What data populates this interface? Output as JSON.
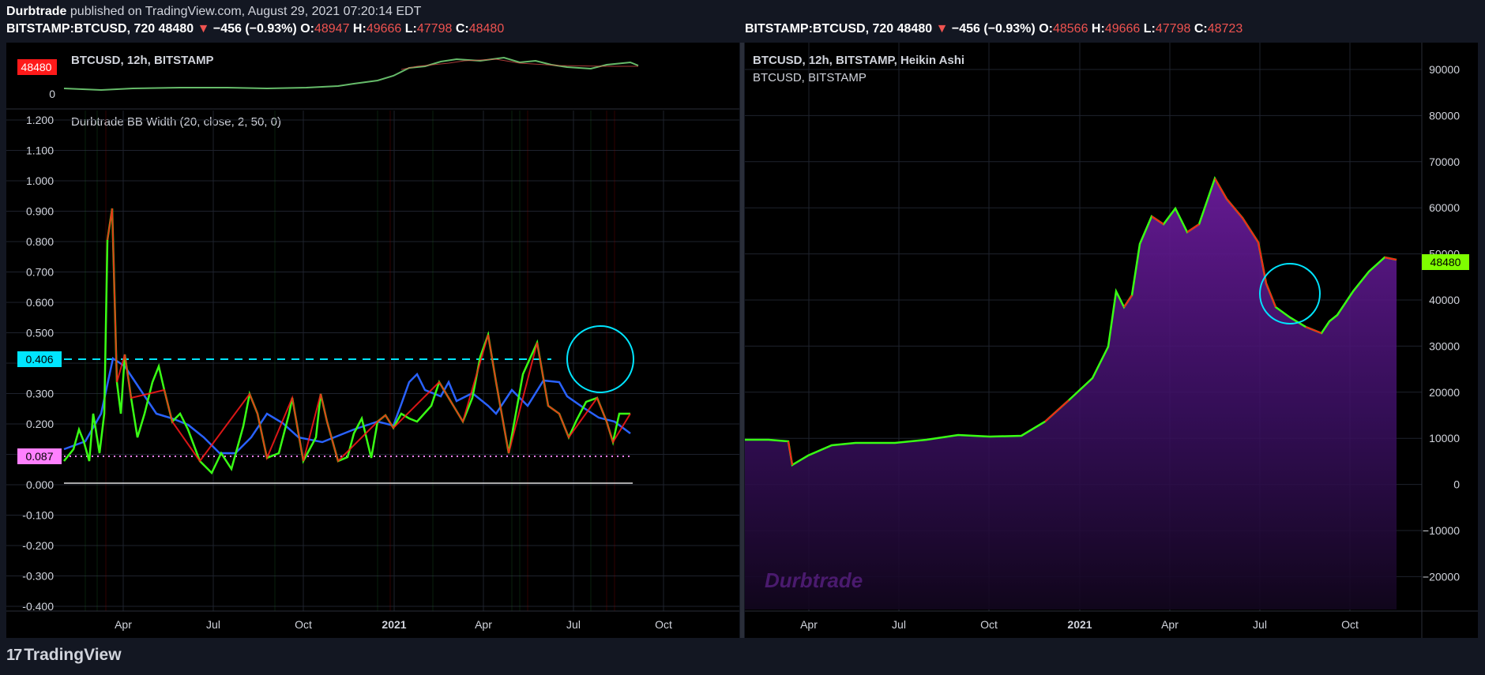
{
  "header": {
    "author": "Durbtrade",
    "published": "published on TradingView.com, August 29, 2021 07:20:14 EDT"
  },
  "left_pane": {
    "symbol_line": {
      "symbol": "BITSTAMP:BTCUSD, 720",
      "last": "48480",
      "arrow": "▼",
      "change": "−456 (−0.93%)",
      "o_label": "O:",
      "o_val": "48947",
      "h_label": "H:",
      "h_val": "49666",
      "l_label": "L:",
      "l_val": "47798",
      "c_label": "C:",
      "c_val": "48480"
    },
    "main_title": "BTCUSD, 12h, BITSTAMP",
    "price_badge": "48480",
    "main_axis_zero": "0",
    "indicator_title": "Durbtrade BB Width (20, close, 2, 50, 0)",
    "y_ticks": [
      "1.200",
      "1.100",
      "1.000",
      "0.900",
      "0.800",
      "0.700",
      "0.600",
      "0.500",
      "0.400",
      "0.300",
      "0.200",
      "0.100",
      "0.000",
      "-0.100",
      "-0.200",
      "-0.300",
      "-0.400"
    ],
    "upper_badge": "0.406",
    "lower_badge": "0.087",
    "x_ticks": [
      "Apr",
      "Jul",
      "Oct",
      "2021",
      "Apr",
      "Jul",
      "Oct"
    ]
  },
  "right_pane": {
    "symbol_line": {
      "symbol": "BITSTAMP:BTCUSD, 720",
      "last": "48480",
      "arrow": "▼",
      "change": "−456 (−0.93%)",
      "o_label": "O:",
      "o_val": "48566",
      "h_label": "H:",
      "h_val": "49666",
      "l_label": "L:",
      "l_val": "47798",
      "c_label": "C:",
      "c_val": "48723"
    },
    "title": "BTCUSD, 12h, BITSTAMP, Heikin Ashi",
    "subtitle": "BTCUSD, BITSTAMP",
    "y_ticks": [
      "90000",
      "80000",
      "70000",
      "60000",
      "50000",
      "40000",
      "30000",
      "20000",
      "10000",
      "0",
      "−10000",
      "−20000"
    ],
    "price_badge": "48480",
    "watermark": "Durbtrade",
    "x_ticks": [
      "Apr",
      "Jul",
      "Oct",
      "2021",
      "Apr",
      "Jul",
      "Oct"
    ]
  },
  "footer": {
    "brand": "TradingView",
    "logo_mark": "17"
  },
  "colors": {
    "bg": "#131722",
    "pane": "#000000",
    "up": "#4caf50",
    "down": "#ef5350",
    "cyan": "#00e5ff",
    "pink": "#ff80ff",
    "purple": "#5b1a8e",
    "badge_green": "#7fff00"
  }
}
